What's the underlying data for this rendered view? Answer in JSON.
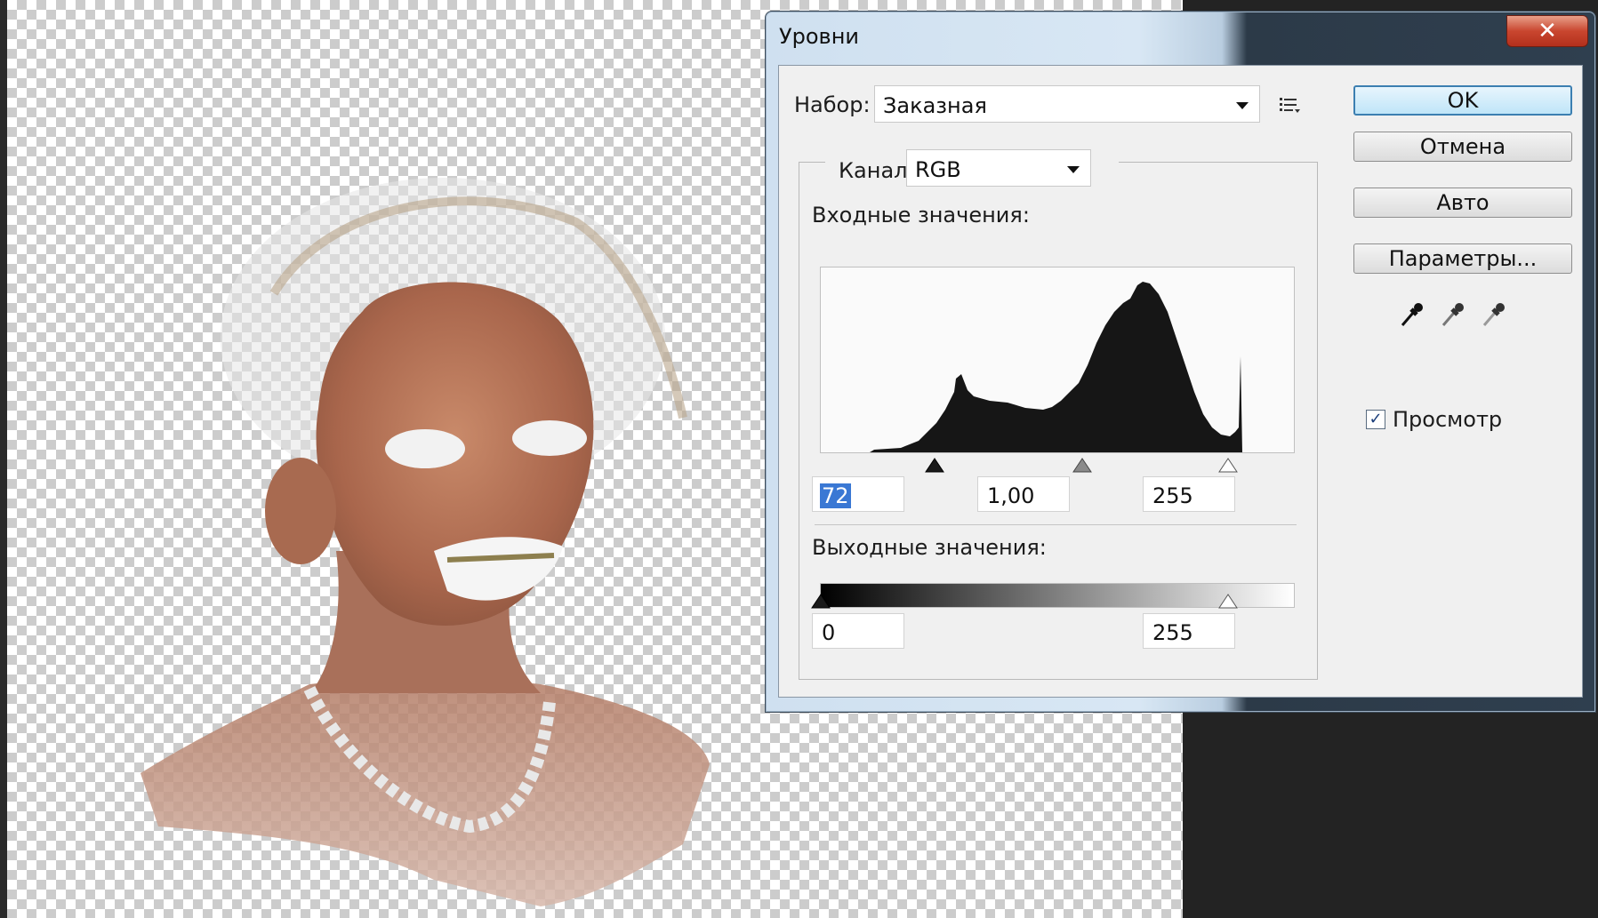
{
  "dialog": {
    "title": "Уровни",
    "close_glyph": "✕",
    "preset_label": "Набор:",
    "preset_value": "Заказная",
    "channel_label": "Канал:",
    "channel_value": "RGB",
    "input_levels_label": "Входные значения:",
    "output_levels_label": "Выходные значения:",
    "input_black": "72",
    "input_gamma": "1,00",
    "input_white": "255",
    "output_black": "0",
    "output_white": "255",
    "buttons": {
      "ok": "OK",
      "cancel": "Отмена",
      "auto": "Авто",
      "options": "Параметры..."
    },
    "preview_label": "Просмотр",
    "preview_checked": true,
    "check_glyph": "✓"
  },
  "icons": {
    "preset_menu": "preset-options-icon",
    "eyedroppers": [
      "black-point-eyedropper-icon",
      "gray-point-eyedropper-icon",
      "white-point-eyedropper-icon"
    ]
  },
  "colors": {
    "titlebar_light": "#cfe0f0",
    "close_button": "#c9462f",
    "default_button_border": "#3c7fb1",
    "selection": "#3a78d4"
  }
}
